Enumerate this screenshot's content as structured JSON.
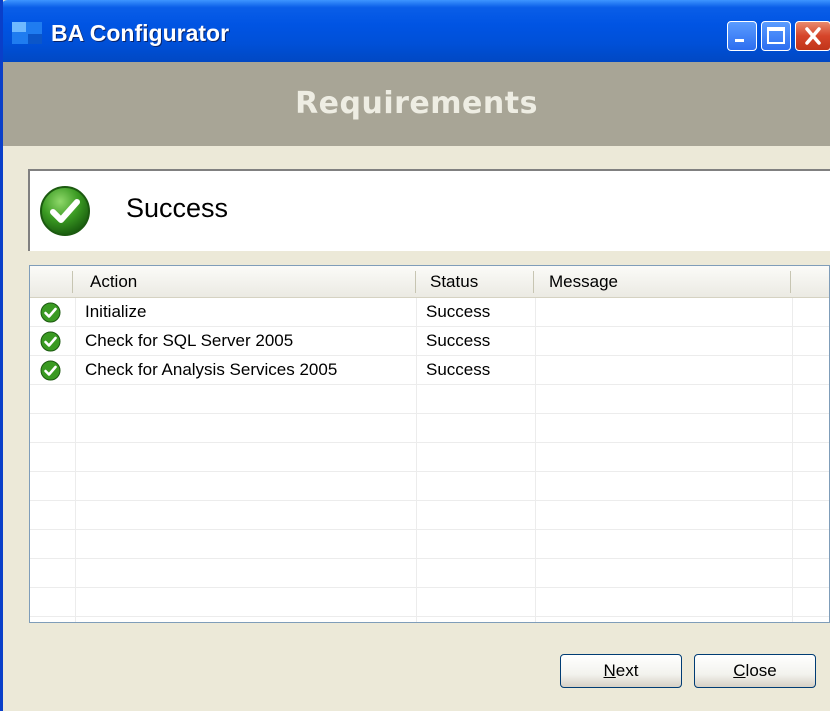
{
  "window": {
    "title": "BA Configurator",
    "header_title": "Requirements"
  },
  "status": {
    "icon": "check-circle-icon",
    "text": "Success"
  },
  "table": {
    "columns": [
      "Action",
      "Status",
      "Message"
    ],
    "rows": [
      {
        "icon": "check-circle-icon",
        "action": "Initialize",
        "status": "Success",
        "message": ""
      },
      {
        "icon": "check-circle-icon",
        "action": "Check for SQL Server 2005",
        "status": "Success",
        "message": ""
      },
      {
        "icon": "check-circle-icon",
        "action": "Check for Analysis Services 2005",
        "status": "Success",
        "message": ""
      }
    ]
  },
  "buttons": {
    "next_mnemonic": "N",
    "next_rest": "ext",
    "close_mnemonic": "C",
    "close_rest": "lose"
  },
  "colors": {
    "titlebar": "#0054e3",
    "header_band": "#a8a596",
    "dialog_bg": "#ece9d8",
    "success_green": "#2e8b1f"
  }
}
